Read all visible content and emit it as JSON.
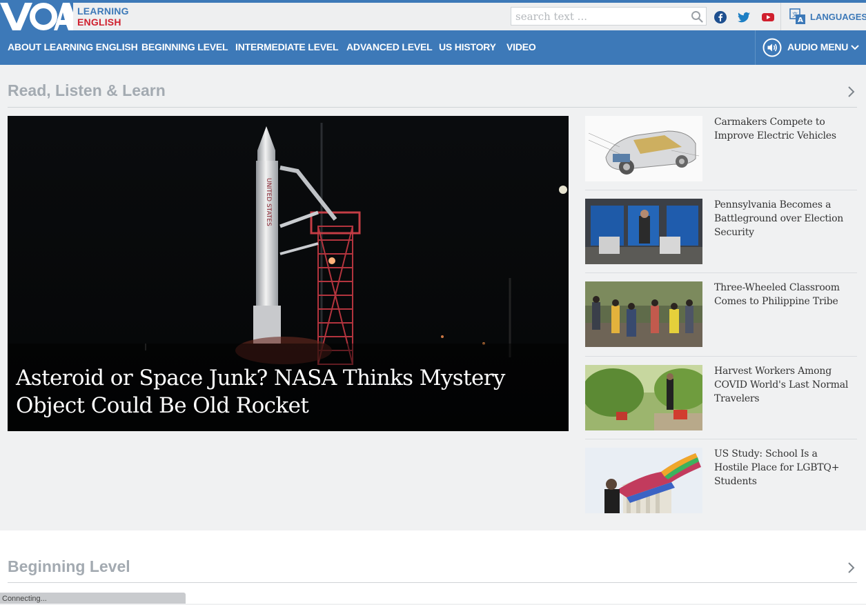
{
  "brand": {
    "logo_mark": "VOA",
    "line1": "LEARNING",
    "line2": "ENGLISH"
  },
  "search": {
    "placeholder": "search text ..."
  },
  "social": [
    "facebook-icon",
    "twitter-icon",
    "youtube-icon"
  ],
  "languages": {
    "label": "LANGUAGES"
  },
  "nav": {
    "items": [
      "ABOUT LEARNING ENGLISH",
      "BEGINNING LEVEL",
      "INTERMEDIATE LEVEL",
      "ADVANCED LEVEL",
      "US HISTORY",
      "VIDEO"
    ],
    "audio_label": "AUDIO MENU"
  },
  "sections": {
    "main_title": "Read, Listen & Learn",
    "beginning_title": "Beginning Level"
  },
  "hero": {
    "title": "Asteroid or Space Junk? NASA Thinks Mystery Object Could Be Old Rocket"
  },
  "stories": [
    {
      "title": "Carmakers Compete to Improve Electric Vehicles"
    },
    {
      "title": "Pennsylvania Becomes a Battleground over Election Security"
    },
    {
      "title": "Three-Wheeled Classroom Comes to Philippine Tribe"
    },
    {
      "title": "Harvest Workers Among COVID World's Last Normal Travelers"
    },
    {
      "title": "US Study: School Is a Hostile Place for LGBTQ+ Students"
    }
  ],
  "status_text": "Connecting...",
  "colors": {
    "brand_blue": "#3d79b8",
    "brand_red": "#d0202e",
    "section_gray": "#a3aab1"
  }
}
